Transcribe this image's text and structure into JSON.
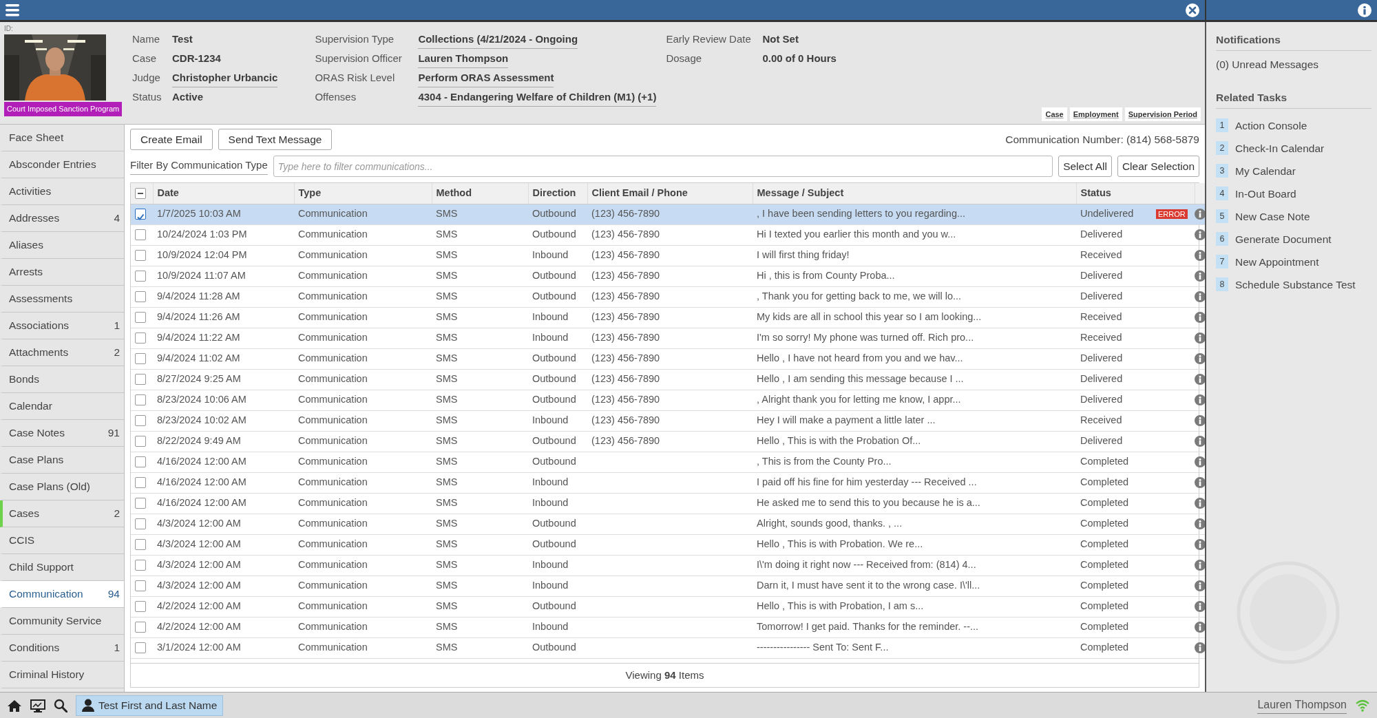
{
  "profile": {
    "id_label": "ID:",
    "program_badge": "Court Imposed Sanction Program",
    "field_groups": [
      [
        {
          "label": "Name",
          "value": "Test",
          "link": false
        },
        {
          "label": "Case",
          "value": "CDR-1234",
          "link": false
        },
        {
          "label": "Judge",
          "value": "Christopher Urbancic",
          "link": true
        },
        {
          "label": "Status",
          "value": "Active",
          "link": false
        }
      ],
      [
        {
          "label": "Supervision Type",
          "value": "Collections (4/21/2024 - Ongoing",
          "link": true
        },
        {
          "label": "Supervision Officer",
          "value": "Lauren Thompson",
          "link": true
        },
        {
          "label": "ORAS Risk Level",
          "value": "Perform ORAS Assessment",
          "link": true
        },
        {
          "label": "Offenses",
          "value": "4304 - Endangering Welfare of Children (M1) (+1)",
          "link": true
        }
      ],
      [
        {
          "label": "Early Review Date",
          "value": "Not Set",
          "link": false
        },
        {
          "label": "Dosage",
          "value": "0.00 of 0 Hours",
          "link": false
        }
      ]
    ],
    "tabs": [
      "Case",
      "Employment",
      "Supervision Period"
    ]
  },
  "sidebar": {
    "items": [
      {
        "label": "Face Sheet",
        "selected": false,
        "flagged": false
      },
      {
        "label": "Absconder Entries",
        "selected": false,
        "flagged": false
      },
      {
        "label": "Activities",
        "selected": false,
        "flagged": false
      },
      {
        "label": "Addresses",
        "count": "4",
        "selected": false,
        "flagged": false
      },
      {
        "label": "Aliases",
        "selected": false,
        "flagged": false
      },
      {
        "label": "Arrests",
        "selected": false,
        "flagged": false
      },
      {
        "label": "Assessments",
        "selected": false,
        "flagged": false
      },
      {
        "label": "Associations",
        "count": "1",
        "selected": false,
        "flagged": false
      },
      {
        "label": "Attachments",
        "count": "2",
        "selected": false,
        "flagged": false
      },
      {
        "label": "Bonds",
        "selected": false,
        "flagged": false
      },
      {
        "label": "Calendar",
        "selected": false,
        "flagged": false
      },
      {
        "label": "Case Notes",
        "count": "91",
        "selected": false,
        "flagged": false
      },
      {
        "label": "Case Plans",
        "selected": false,
        "flagged": false
      },
      {
        "label": "Case Plans (Old)",
        "selected": false,
        "flagged": false
      },
      {
        "label": "Cases",
        "count": "2",
        "selected": false,
        "flagged": true
      },
      {
        "label": "CCIS",
        "selected": false,
        "flagged": false
      },
      {
        "label": "Child Support",
        "selected": false,
        "flagged": false
      },
      {
        "label": "Communication",
        "count": "94",
        "selected": true,
        "flagged": false
      },
      {
        "label": "Community Service",
        "selected": false,
        "flagged": false
      },
      {
        "label": "Conditions",
        "count": "1",
        "selected": false,
        "flagged": false
      },
      {
        "label": "Criminal History",
        "selected": false,
        "flagged": false
      }
    ]
  },
  "toolbar": {
    "buttons": [
      "Create Email",
      "Send Text Message"
    ],
    "communication_number": "Communication Number: (814) 568-5879"
  },
  "filter": {
    "label": "Filter By Communication Type",
    "placeholder": "Type here to filter communications...",
    "buttons": [
      "Select All",
      "Clear Selection"
    ]
  },
  "table": {
    "select_all_indeterminate": true,
    "columns": [
      "Date",
      "Type",
      "Method",
      "Direction",
      "Client Email / Phone",
      "Message / Subject",
      "Status"
    ],
    "rows": [
      {
        "date": "1/7/2025 10:03 AM",
        "type": "Communication",
        "method": "SMS",
        "direction": "Outbound",
        "contact": "(123) 456-7890",
        "message": ", I have been sending letters to you regarding...",
        "status": "Undelivered",
        "error": "ERROR",
        "checked": true,
        "selected": true
      },
      {
        "date": "10/24/2024 1:03 PM",
        "type": "Communication",
        "method": "SMS",
        "direction": "Outbound",
        "contact": "(123) 456-7890",
        "message": "Hi I texted you earlier this month and you w...",
        "status": "Delivered",
        "checked": false,
        "selected": false
      },
      {
        "date": "10/9/2024 12:04 PM",
        "type": "Communication",
        "method": "SMS",
        "direction": "Inbound",
        "contact": "(123) 456-7890",
        "message": "I will first thing friday!",
        "status": "Received",
        "checked": false,
        "selected": false
      },
      {
        "date": "10/9/2024 11:07 AM",
        "type": "Communication",
        "method": "SMS",
        "direction": "Outbound",
        "contact": "(123) 456-7890",
        "message": "Hi , this is from County Proba...",
        "status": "Delivered",
        "checked": false,
        "selected": false
      },
      {
        "date": "9/4/2024 11:28 AM",
        "type": "Communication",
        "method": "SMS",
        "direction": "Outbound",
        "contact": "(123) 456-7890",
        "message": ", Thank you for getting back to me, we will lo...",
        "status": "Delivered",
        "checked": false,
        "selected": false
      },
      {
        "date": "9/4/2024 11:26 AM",
        "type": "Communication",
        "method": "SMS",
        "direction": "Inbound",
        "contact": "(123) 456-7890",
        "message": "My kids are all in school this year so I am looking...",
        "status": "Received",
        "checked": false,
        "selected": false
      },
      {
        "date": "9/4/2024 11:22 AM",
        "type": "Communication",
        "method": "SMS",
        "direction": "Inbound",
        "contact": "(123) 456-7890",
        "message": "I'm so sorry! My phone was turned off. Rich pro...",
        "status": "Received",
        "checked": false,
        "selected": false
      },
      {
        "date": "9/4/2024 11:02 AM",
        "type": "Communication",
        "method": "SMS",
        "direction": "Outbound",
        "contact": "(123) 456-7890",
        "message": "Hello , I have not heard from you and we hav...",
        "status": "Delivered",
        "checked": false,
        "selected": false
      },
      {
        "date": "8/27/2024 9:25 AM",
        "type": "Communication",
        "method": "SMS",
        "direction": "Outbound",
        "contact": "(123) 456-7890",
        "message": "Hello , I am sending this message because I ...",
        "status": "Delivered",
        "checked": false,
        "selected": false
      },
      {
        "date": "8/23/2024 10:06 AM",
        "type": "Communication",
        "method": "SMS",
        "direction": "Outbound",
        "contact": "(123) 456-7890",
        "message": ", Alright thank you for letting me know, I appr...",
        "status": "Delivered",
        "checked": false,
        "selected": false
      },
      {
        "date": "8/23/2024 10:02 AM",
        "type": "Communication",
        "method": "SMS",
        "direction": "Inbound",
        "contact": "(123) 456-7890",
        "message": "Hey I will make a payment a little later ...",
        "status": "Received",
        "checked": false,
        "selected": false
      },
      {
        "date": "8/22/2024 9:49 AM",
        "type": "Communication",
        "method": "SMS",
        "direction": "Outbound",
        "contact": "(123) 456-7890",
        "message": "Hello , This is with the Probation Of...",
        "status": "Delivered",
        "checked": false,
        "selected": false
      },
      {
        "date": "4/16/2024 12:00 AM",
        "type": "Communication",
        "method": "SMS",
        "direction": "Outbound",
        "message": ", This is from the County Pro...",
        "status": "Completed",
        "checked": false,
        "selected": false
      },
      {
        "date": "4/16/2024 12:00 AM",
        "type": "Communication",
        "method": "SMS",
        "direction": "Inbound",
        "message": "I paid off his fine for him yesterday --- Received ...",
        "status": "Completed",
        "checked": false,
        "selected": false
      },
      {
        "date": "4/16/2024 12:00 AM",
        "type": "Communication",
        "method": "SMS",
        "direction": "Inbound",
        "message": "He asked me to send this to you because he is a...",
        "status": "Completed",
        "checked": false,
        "selected": false
      },
      {
        "date": "4/3/2024 12:00 AM",
        "type": "Communication",
        "method": "SMS",
        "direction": "Outbound",
        "message": "Alright, sounds good, thanks. , ...",
        "status": "Completed",
        "checked": false,
        "selected": false
      },
      {
        "date": "4/3/2024 12:00 AM",
        "type": "Communication",
        "method": "SMS",
        "direction": "Outbound",
        "message": "Hello , This is with Probation. We re...",
        "status": "Completed",
        "checked": false,
        "selected": false
      },
      {
        "date": "4/3/2024 12:00 AM",
        "type": "Communication",
        "method": "SMS",
        "direction": "Inbound",
        "message": "I\\'m doing it right now --- Received from: (814) 4...",
        "status": "Completed",
        "checked": false,
        "selected": false
      },
      {
        "date": "4/3/2024 12:00 AM",
        "type": "Communication",
        "method": "SMS",
        "direction": "Inbound",
        "message": "Darn it, I must have sent it to the wrong case. I\\'ll...",
        "status": "Completed",
        "checked": false,
        "selected": false
      },
      {
        "date": "4/2/2024 12:00 AM",
        "type": "Communication",
        "method": "SMS",
        "direction": "Outbound",
        "message": "Hello , This is with Probation, I am s...",
        "status": "Completed",
        "checked": false,
        "selected": false
      },
      {
        "date": "4/2/2024 12:00 AM",
        "type": "Communication",
        "method": "SMS",
        "direction": "Inbound",
        "message": "Tomorrow! I get paid. Thanks for the reminder. --...",
        "status": "Completed",
        "checked": false,
        "selected": false
      },
      {
        "date": "3/1/2024 12:00 AM",
        "type": "Communication",
        "method": "SMS",
        "direction": "Outbound",
        "message": "---------------- Sent To: Sent F...",
        "status": "Completed",
        "checked": false,
        "selected": false
      }
    ],
    "footer": "Viewing **94** Items"
  },
  "right_panel": {
    "notifications_title": "Notifications",
    "unread": "(0) Unread Messages",
    "tasks_title": "Related Tasks",
    "tasks": [
      {
        "number": "1",
        "label": "Action Console"
      },
      {
        "number": "2",
        "label": "Check-In Calendar"
      },
      {
        "number": "3",
        "label": "My Calendar"
      },
      {
        "number": "4",
        "label": "In-Out Board"
      },
      {
        "number": "5",
        "label": "New Case Note"
      },
      {
        "number": "6",
        "label": "Generate Document"
      },
      {
        "number": "7",
        "label": "New Appointment"
      },
      {
        "number": "8",
        "label": "Schedule Substance Test"
      }
    ]
  },
  "status_bar": {
    "open_record": "Test First and Last Name",
    "user": "Lauren Thompson"
  }
}
